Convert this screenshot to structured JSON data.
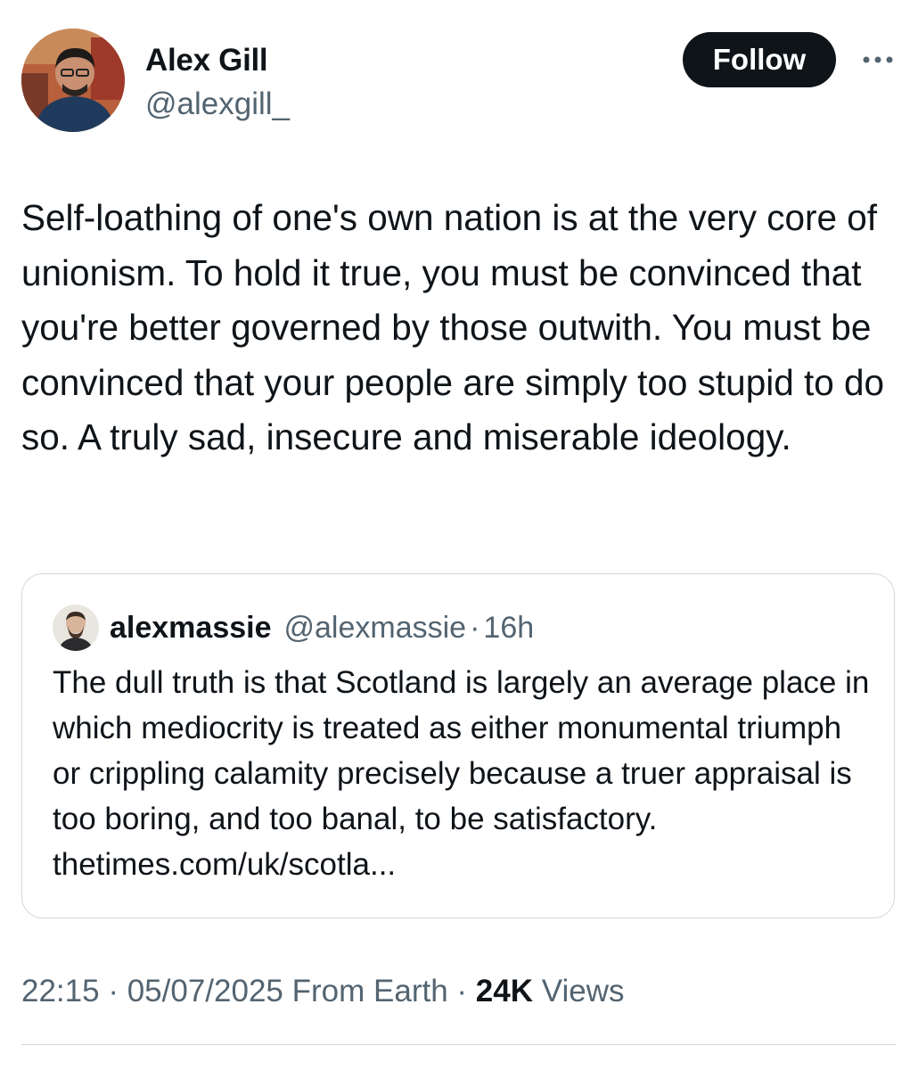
{
  "author": {
    "name": "Alex Gill",
    "handle": "@alexgill_"
  },
  "follow_label": "Follow",
  "tweet": {
    "text": "Self-loathing of one's own nation is at the very core of unionism. To hold it true, you must be convinced that you're better governed by those outwith. You must be convinced that your people are simply too stupid to do so. A truly sad, insecure and miserable ideology."
  },
  "quoted_tweet": {
    "name": "alexmassie",
    "handle": "@alexmassie",
    "separator": "·",
    "time": "16h",
    "text": "The dull truth is that Scotland is largely an average place in which mediocrity is treated as either monumental triumph or crippling calamity precisely because a truer appraisal is too boring, and too banal, to be satisfactory. thetimes.com/uk/scotla..."
  },
  "meta": {
    "time": "22:15",
    "separator": "·",
    "date": "05/07/2025",
    "source": "From Earth",
    "views_count": "24K",
    "views_label": "Views"
  },
  "icons": {
    "more": "more-horizontal-icon"
  },
  "colors": {
    "text_primary": "#0f1419",
    "text_secondary": "#536471",
    "border": "#cfd9de",
    "follow_bg": "#0f1419"
  }
}
